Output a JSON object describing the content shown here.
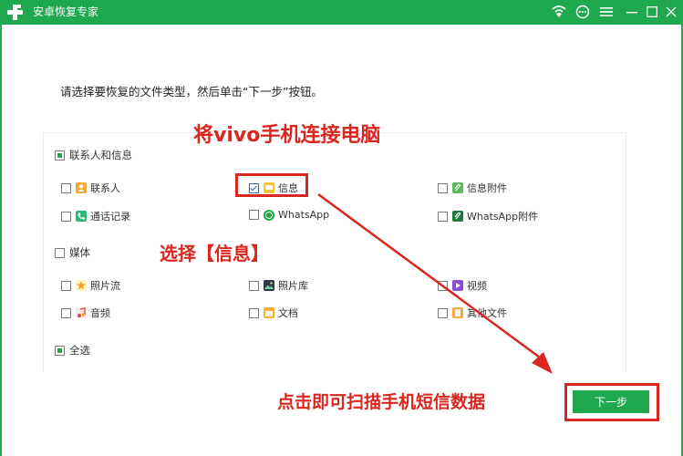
{
  "window": {
    "title": "安卓恢复专家",
    "controls": [
      "wifi-icon",
      "chat-icon",
      "menu-icon",
      "minimize-icon",
      "maximize-icon",
      "close-icon"
    ]
  },
  "instruction": "请选择要恢复的文件类型，然后单击“下一步”按钮。",
  "sections": {
    "contacts_messages": {
      "label": "联系人和信息",
      "state": "partial",
      "items": [
        {
          "label": "联系人",
          "icon": "contacts-icon",
          "checked": false
        },
        {
          "label": "信息",
          "icon": "message-icon",
          "checked": true
        },
        {
          "label": "信息附件",
          "icon": "attachment-icon",
          "checked": false
        },
        {
          "label": "通话记录",
          "icon": "phone-icon",
          "checked": false
        },
        {
          "label": "WhatsApp",
          "icon": "whatsapp-icon",
          "checked": false
        },
        {
          "label": "WhatsApp附件",
          "icon": "whatsapp-attachment-icon",
          "checked": false
        }
      ]
    },
    "media": {
      "label": "媒体",
      "state": "unchecked",
      "items": [
        {
          "label": "照片流",
          "icon": "photo-stream-icon",
          "checked": false
        },
        {
          "label": "照片库",
          "icon": "photo-library-icon",
          "checked": false
        },
        {
          "label": "视频",
          "icon": "video-icon",
          "checked": false
        },
        {
          "label": "音频",
          "icon": "audio-icon",
          "checked": false
        },
        {
          "label": "文档",
          "icon": "document-icon",
          "checked": false
        },
        {
          "label": "其他文件",
          "icon": "other-files-icon",
          "checked": false
        }
      ]
    },
    "select_all": {
      "label": "全选",
      "state": "partial"
    }
  },
  "next_button": {
    "label": "下一步"
  },
  "annotations": {
    "connect": "将vivo手机连接电脑",
    "select": "选择【信息】",
    "click": "点击即可扫描手机短信数据"
  },
  "colors": {
    "accent": "#1fa84d",
    "annotation": "#d9261f",
    "checkbox_check": "#1f6fb5"
  }
}
